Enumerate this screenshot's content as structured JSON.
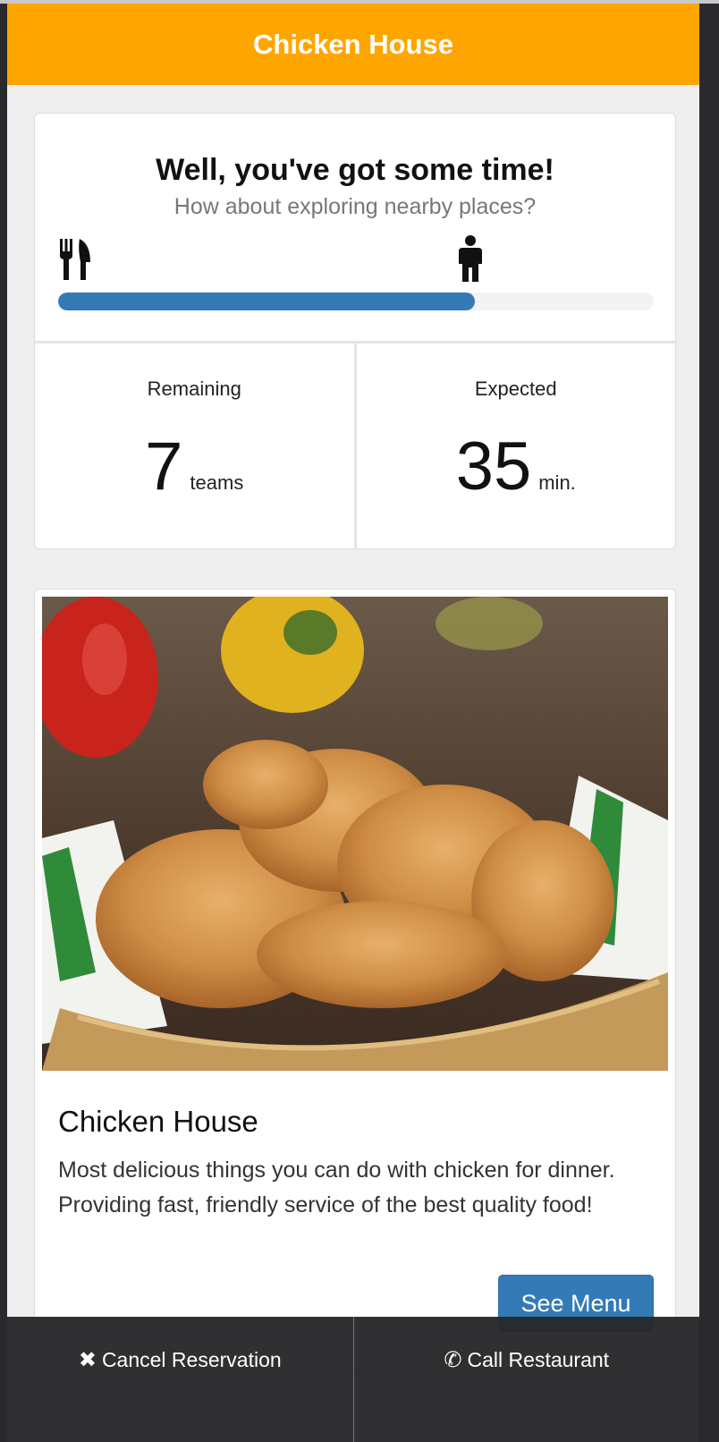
{
  "header": {
    "title": "Chicken House"
  },
  "wait": {
    "title": "Well, you've got some time!",
    "subtitle": "How about exploring nearby places?",
    "progress_fraction": 0.7,
    "icons": {
      "start": "fork-knife-icon",
      "end": "person-icon"
    },
    "progress_color": "#337ab7"
  },
  "stats": {
    "remaining": {
      "label": "Remaining",
      "value": "7",
      "unit": "teams"
    },
    "expected": {
      "label": "Expected",
      "value": "35",
      "unit": "min."
    }
  },
  "restaurant": {
    "photo": "fried-chicken-photo",
    "name": "Chicken House",
    "description": "Most delicious things you can do with chicken for dinner. Providing fast, friendly service of the best quality food!",
    "menu_button": "See Menu"
  },
  "footer": {
    "cancel": {
      "icon": "close-icon",
      "label": "Cancel Reservation"
    },
    "call": {
      "icon": "phone-icon",
      "label": "Call Restaurant"
    }
  },
  "colors": {
    "header": "#ffa500",
    "primary": "#337ab7",
    "footer": "#2b2b2d"
  }
}
